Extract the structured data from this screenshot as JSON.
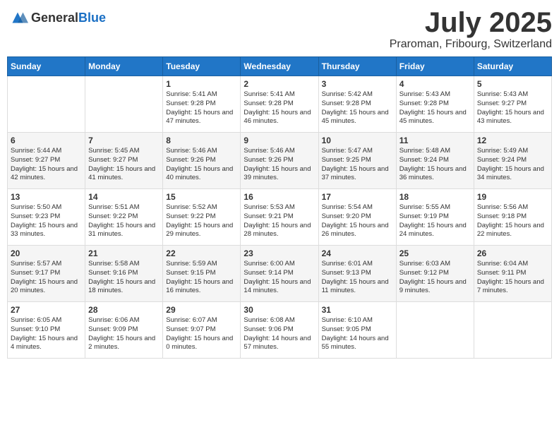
{
  "header": {
    "logo_general": "General",
    "logo_blue": "Blue",
    "month_title": "July 2025",
    "location": "Praroman, Fribourg, Switzerland"
  },
  "weekdays": [
    "Sunday",
    "Monday",
    "Tuesday",
    "Wednesday",
    "Thursday",
    "Friday",
    "Saturday"
  ],
  "weeks": [
    [
      {
        "day": "",
        "info": ""
      },
      {
        "day": "",
        "info": ""
      },
      {
        "day": "1",
        "info": "Sunrise: 5:41 AM\nSunset: 9:28 PM\nDaylight: 15 hours and 47 minutes."
      },
      {
        "day": "2",
        "info": "Sunrise: 5:41 AM\nSunset: 9:28 PM\nDaylight: 15 hours and 46 minutes."
      },
      {
        "day": "3",
        "info": "Sunrise: 5:42 AM\nSunset: 9:28 PM\nDaylight: 15 hours and 45 minutes."
      },
      {
        "day": "4",
        "info": "Sunrise: 5:43 AM\nSunset: 9:28 PM\nDaylight: 15 hours and 45 minutes."
      },
      {
        "day": "5",
        "info": "Sunrise: 5:43 AM\nSunset: 9:27 PM\nDaylight: 15 hours and 43 minutes."
      }
    ],
    [
      {
        "day": "6",
        "info": "Sunrise: 5:44 AM\nSunset: 9:27 PM\nDaylight: 15 hours and 42 minutes."
      },
      {
        "day": "7",
        "info": "Sunrise: 5:45 AM\nSunset: 9:27 PM\nDaylight: 15 hours and 41 minutes."
      },
      {
        "day": "8",
        "info": "Sunrise: 5:46 AM\nSunset: 9:26 PM\nDaylight: 15 hours and 40 minutes."
      },
      {
        "day": "9",
        "info": "Sunrise: 5:46 AM\nSunset: 9:26 PM\nDaylight: 15 hours and 39 minutes."
      },
      {
        "day": "10",
        "info": "Sunrise: 5:47 AM\nSunset: 9:25 PM\nDaylight: 15 hours and 37 minutes."
      },
      {
        "day": "11",
        "info": "Sunrise: 5:48 AM\nSunset: 9:24 PM\nDaylight: 15 hours and 36 minutes."
      },
      {
        "day": "12",
        "info": "Sunrise: 5:49 AM\nSunset: 9:24 PM\nDaylight: 15 hours and 34 minutes."
      }
    ],
    [
      {
        "day": "13",
        "info": "Sunrise: 5:50 AM\nSunset: 9:23 PM\nDaylight: 15 hours and 33 minutes."
      },
      {
        "day": "14",
        "info": "Sunrise: 5:51 AM\nSunset: 9:22 PM\nDaylight: 15 hours and 31 minutes."
      },
      {
        "day": "15",
        "info": "Sunrise: 5:52 AM\nSunset: 9:22 PM\nDaylight: 15 hours and 29 minutes."
      },
      {
        "day": "16",
        "info": "Sunrise: 5:53 AM\nSunset: 9:21 PM\nDaylight: 15 hours and 28 minutes."
      },
      {
        "day": "17",
        "info": "Sunrise: 5:54 AM\nSunset: 9:20 PM\nDaylight: 15 hours and 26 minutes."
      },
      {
        "day": "18",
        "info": "Sunrise: 5:55 AM\nSunset: 9:19 PM\nDaylight: 15 hours and 24 minutes."
      },
      {
        "day": "19",
        "info": "Sunrise: 5:56 AM\nSunset: 9:18 PM\nDaylight: 15 hours and 22 minutes."
      }
    ],
    [
      {
        "day": "20",
        "info": "Sunrise: 5:57 AM\nSunset: 9:17 PM\nDaylight: 15 hours and 20 minutes."
      },
      {
        "day": "21",
        "info": "Sunrise: 5:58 AM\nSunset: 9:16 PM\nDaylight: 15 hours and 18 minutes."
      },
      {
        "day": "22",
        "info": "Sunrise: 5:59 AM\nSunset: 9:15 PM\nDaylight: 15 hours and 16 minutes."
      },
      {
        "day": "23",
        "info": "Sunrise: 6:00 AM\nSunset: 9:14 PM\nDaylight: 15 hours and 14 minutes."
      },
      {
        "day": "24",
        "info": "Sunrise: 6:01 AM\nSunset: 9:13 PM\nDaylight: 15 hours and 11 minutes."
      },
      {
        "day": "25",
        "info": "Sunrise: 6:03 AM\nSunset: 9:12 PM\nDaylight: 15 hours and 9 minutes."
      },
      {
        "day": "26",
        "info": "Sunrise: 6:04 AM\nSunset: 9:11 PM\nDaylight: 15 hours and 7 minutes."
      }
    ],
    [
      {
        "day": "27",
        "info": "Sunrise: 6:05 AM\nSunset: 9:10 PM\nDaylight: 15 hours and 4 minutes."
      },
      {
        "day": "28",
        "info": "Sunrise: 6:06 AM\nSunset: 9:09 PM\nDaylight: 15 hours and 2 minutes."
      },
      {
        "day": "29",
        "info": "Sunrise: 6:07 AM\nSunset: 9:07 PM\nDaylight: 15 hours and 0 minutes."
      },
      {
        "day": "30",
        "info": "Sunrise: 6:08 AM\nSunset: 9:06 PM\nDaylight: 14 hours and 57 minutes."
      },
      {
        "day": "31",
        "info": "Sunrise: 6:10 AM\nSunset: 9:05 PM\nDaylight: 14 hours and 55 minutes."
      },
      {
        "day": "",
        "info": ""
      },
      {
        "day": "",
        "info": ""
      }
    ]
  ]
}
